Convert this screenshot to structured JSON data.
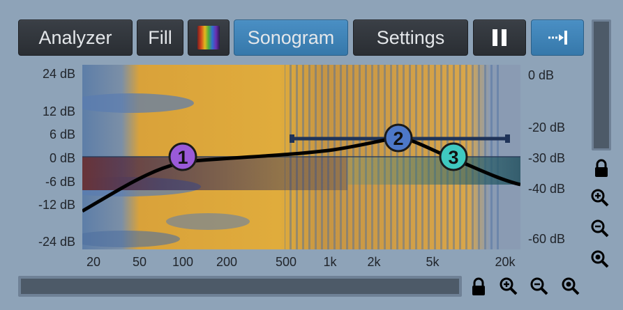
{
  "toolbar": {
    "analyzer_label": "Analyzer",
    "fill_label": "Fill",
    "palette_icon": "color-palette-icon",
    "sonogram_label": "Sonogram",
    "settings_label": "Settings",
    "pause_icon": "pause-icon",
    "follow_icon": "arrow-to-right-icon"
  },
  "axis_left": [
    "24 dB",
    "12 dB",
    "6 dB",
    "0 dB",
    "-6 dB",
    "-12 dB",
    "-24 dB"
  ],
  "axis_right": [
    "0 dB",
    "-20 dB",
    "-30 dB",
    "-40 dB",
    "-60 dB"
  ],
  "axis_x": [
    "20",
    "50",
    "100",
    "200",
    "500",
    "1k",
    "2k",
    "5k",
    "20k"
  ],
  "bands": [
    {
      "label": "1",
      "color": "#9a5ad8"
    },
    {
      "label": "2",
      "color": "#4d78c8"
    },
    {
      "label": "3",
      "color": "#3fc9c0"
    }
  ],
  "side_icons": [
    "lock-icon",
    "zoom-in-icon",
    "zoom-out-icon",
    "zoom-reset-icon"
  ],
  "bottom_icons": [
    "lock-icon",
    "zoom-in-icon",
    "zoom-out-icon",
    "zoom-reset-icon"
  ],
  "colors": {
    "background": "#8ea3b8",
    "button": "#2f343a",
    "button_active": "#3f86bb",
    "curve": "#000000"
  }
}
